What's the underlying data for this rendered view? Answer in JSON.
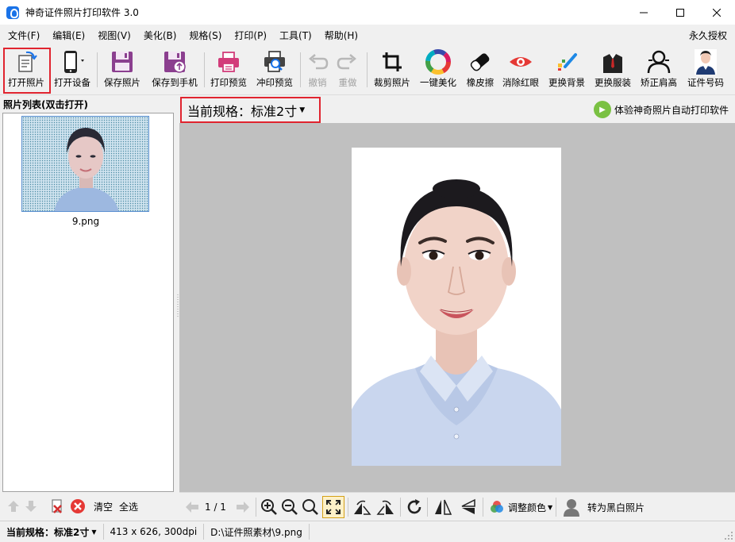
{
  "window": {
    "title": "神奇证件照片打印软件 3.0",
    "minimize": "minimize",
    "maximize": "maximize",
    "close": "close"
  },
  "menu": {
    "items": [
      "文件(F)",
      "编辑(E)",
      "视图(V)",
      "美化(B)",
      "规格(S)",
      "打印(P)",
      "工具(T)",
      "帮助(H)"
    ],
    "license": "永久授权"
  },
  "toolbar": {
    "open_photo": "打开照片",
    "open_device": "打开设备",
    "save_photo": "保存照片",
    "save_to_phone": "保存到手机",
    "print_preview": "打印预览",
    "develop_preview": "冲印预览",
    "undo": "撤销",
    "redo": "重做",
    "crop": "裁剪照片",
    "one_click_beautify": "一键美化",
    "eraser": "橡皮擦",
    "remove_red_eye": "消除红眼",
    "change_background": "更换背景",
    "change_clothes": "更换服装",
    "correct_shoulders": "矫正肩高",
    "id_number": "证件号码"
  },
  "photo_list": {
    "header": "照片列表(双击打开)",
    "items": [
      {
        "filename": "9.png"
      }
    ],
    "clear": "清空",
    "select_all": "全选"
  },
  "spec": {
    "label": "当前规格：",
    "value": "标准2寸",
    "promo": "体验神奇照片自动打印软件"
  },
  "bottom_tools": {
    "page": "1 / 1",
    "adjust_color": "调整颜色",
    "to_bw": "转为黑白照片"
  },
  "status": {
    "spec_label": "当前规格：",
    "spec_value": "标准2寸",
    "dimensions": "413 x 626, 300dpi",
    "path": "D:\\证件照素材\\9.png"
  },
  "colors": {
    "highlight": "#e0242f",
    "canvas_bg": "#c0c0c0",
    "accent_blue": "#1a73e8"
  }
}
